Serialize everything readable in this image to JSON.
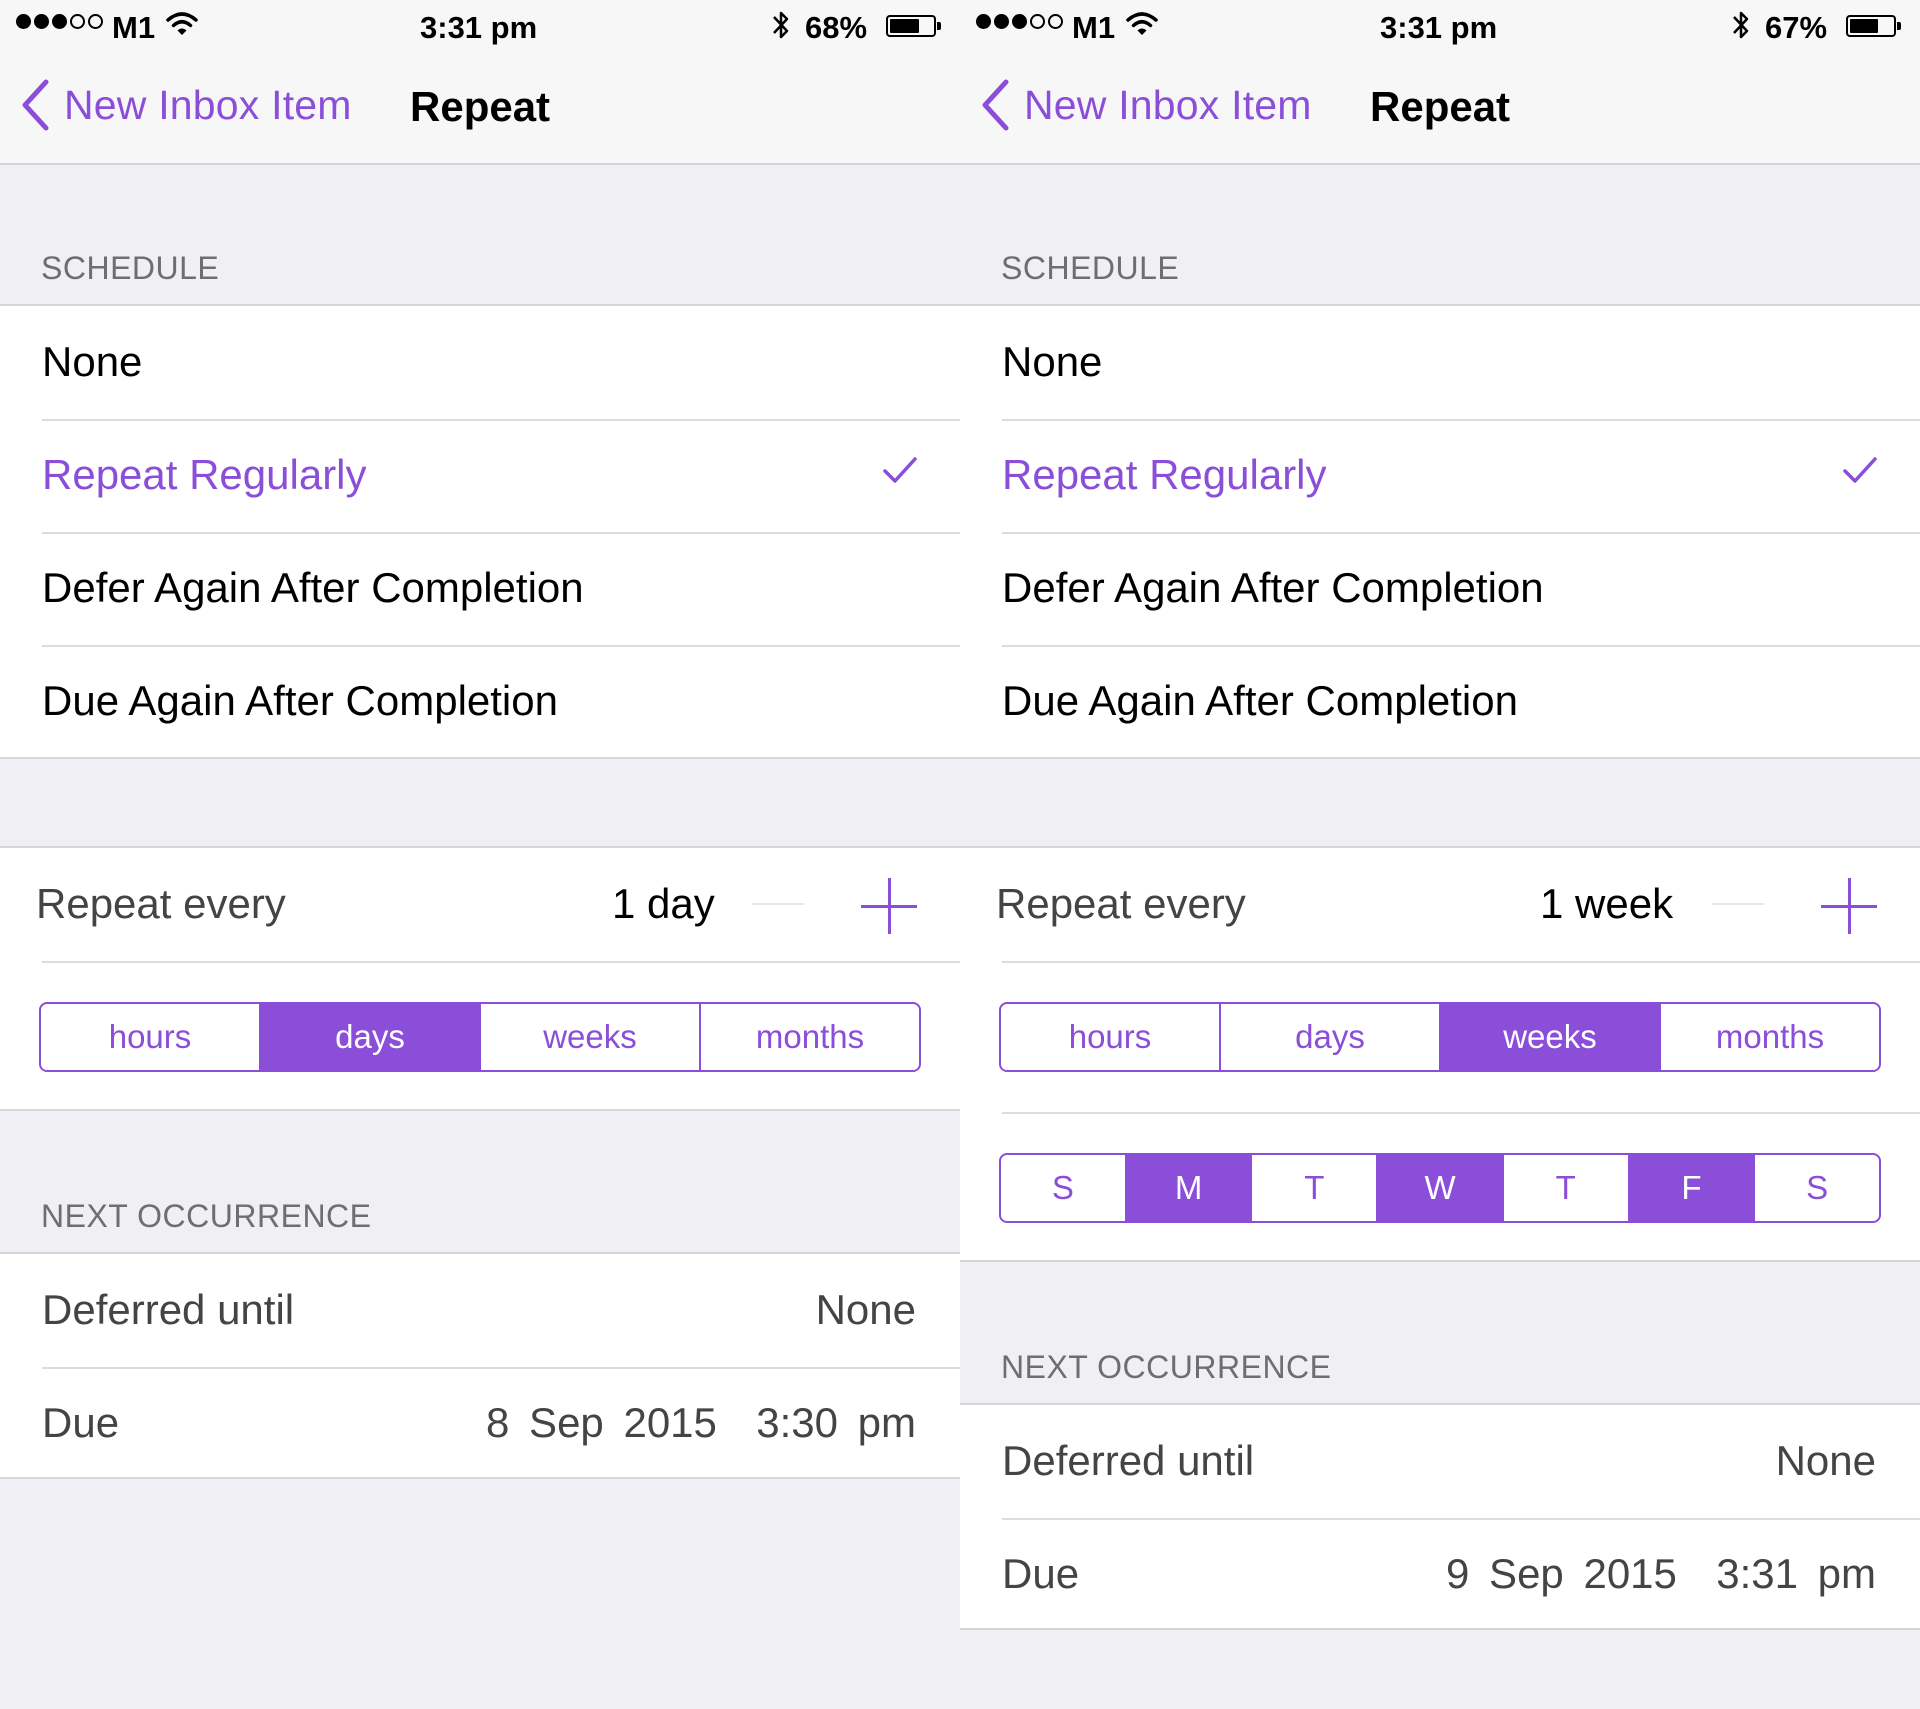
{
  "colors": {
    "accent": "#8b4ed8",
    "background": "#efeff4"
  },
  "screens": [
    {
      "status": {
        "signal_full": 3,
        "signal_total": 5,
        "carrier": "M1",
        "time": "3:31 pm",
        "battery_text": "68%",
        "battery_level": 0.68,
        "icons": [
          "wifi-icon",
          "bluetooth-icon",
          "battery-icon"
        ]
      },
      "nav": {
        "back_label": "New Inbox Item",
        "title": "Repeat"
      },
      "schedule_header": "SCHEDULE",
      "schedule_options": [
        {
          "label": "None",
          "selected": false
        },
        {
          "label": "Repeat Regularly",
          "selected": true
        },
        {
          "label": "Defer Again After Completion",
          "selected": false
        },
        {
          "label": "Due Again After Completion",
          "selected": false
        }
      ],
      "repeat": {
        "label": "Repeat every",
        "value": "1 day",
        "minus": "—",
        "plus": "+"
      },
      "units": [
        {
          "label": "hours",
          "selected": false
        },
        {
          "label": "days",
          "selected": true
        },
        {
          "label": "weeks",
          "selected": false
        },
        {
          "label": "months",
          "selected": false
        }
      ],
      "next_header": "NEXT OCCURRENCE",
      "deferred": {
        "label": "Deferred until",
        "value": "None"
      },
      "due": {
        "label": "Due",
        "value": "8 Sep 2015  3:30 pm"
      }
    },
    {
      "status": {
        "signal_full": 3,
        "signal_total": 5,
        "carrier": "M1",
        "time": "3:31 pm",
        "battery_text": "67%",
        "battery_level": 0.67,
        "icons": [
          "wifi-icon",
          "bluetooth-icon",
          "battery-icon"
        ]
      },
      "nav": {
        "back_label": "New Inbox Item",
        "title": "Repeat"
      },
      "schedule_header": "SCHEDULE",
      "schedule_options": [
        {
          "label": "None",
          "selected": false
        },
        {
          "label": "Repeat Regularly",
          "selected": true
        },
        {
          "label": "Defer Again After Completion",
          "selected": false
        },
        {
          "label": "Due Again After Completion",
          "selected": false
        }
      ],
      "repeat": {
        "label": "Repeat every",
        "value": "1 week",
        "minus": "—",
        "plus": "+"
      },
      "units": [
        {
          "label": "hours",
          "selected": false
        },
        {
          "label": "days",
          "selected": false
        },
        {
          "label": "weeks",
          "selected": true
        },
        {
          "label": "months",
          "selected": false
        }
      ],
      "weekdays": [
        {
          "label": "S",
          "selected": false
        },
        {
          "label": "M",
          "selected": true
        },
        {
          "label": "T",
          "selected": false
        },
        {
          "label": "W",
          "selected": true
        },
        {
          "label": "T",
          "selected": false
        },
        {
          "label": "F",
          "selected": true
        },
        {
          "label": "S",
          "selected": false
        }
      ],
      "next_header": "NEXT OCCURRENCE",
      "deferred": {
        "label": "Deferred until",
        "value": "None"
      },
      "due": {
        "label": "Due",
        "value": "9 Sep 2015  3:31 pm"
      }
    }
  ]
}
